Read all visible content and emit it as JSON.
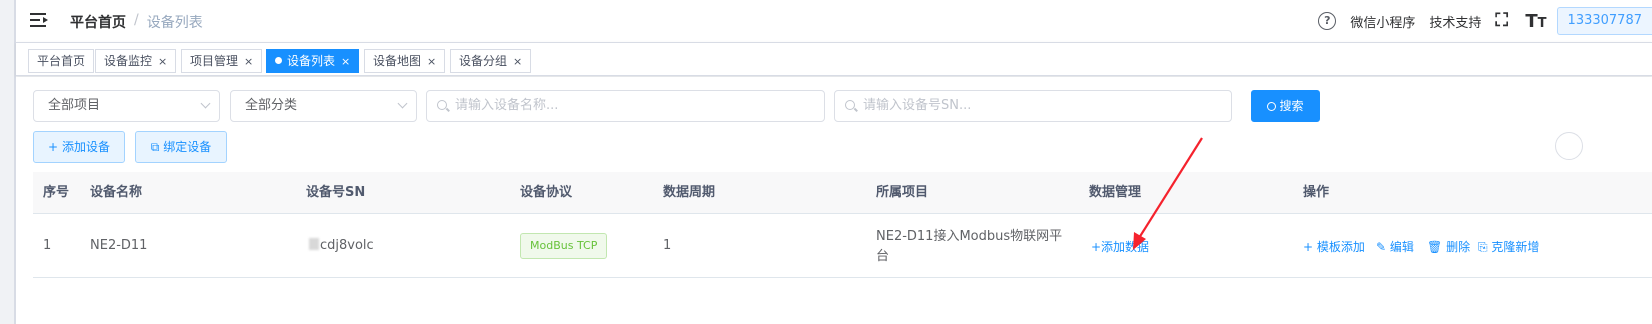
{
  "navbar": {
    "breadcrumb": {
      "home": "平台首页",
      "separator": "/",
      "current": "设备列表"
    },
    "right": {
      "mini_program": "微信小程序",
      "tech_support": "技术支持",
      "user": "133307787"
    }
  },
  "tags": [
    {
      "label": "平台首页",
      "closable": false
    },
    {
      "label": "设备监控",
      "closable": true
    },
    {
      "label": "项目管理",
      "closable": true
    },
    {
      "label": "设备列表",
      "closable": true,
      "active": true
    },
    {
      "label": "设备地图",
      "closable": true
    },
    {
      "label": "设备分组",
      "closable": true
    }
  ],
  "tag_close": "×",
  "filters": {
    "project_select": "全部项目",
    "category_select": "全部分类",
    "name_placeholder": "请输入设备名称...",
    "sn_placeholder": "请输入设备号SN...",
    "search_label": "搜索"
  },
  "actions": {
    "add_device": "添加设备",
    "bind_device": "绑定设备"
  },
  "table": {
    "headers": [
      "序号",
      "设备名称",
      "设备号SN",
      "设备协议",
      "数据周期",
      "所属项目",
      "数据管理",
      "操作"
    ],
    "rows": [
      {
        "index": "1",
        "name": "NE2-D11",
        "sn": "cdj8volc",
        "protocol": "ModBus TCP",
        "period": "1",
        "project_line1": "NE2-D11接入Modbus物联网平",
        "project_line2": "台",
        "data_mgmt": "+添加数据",
        "ops": {
          "template_add": "模板添加",
          "edit": "编辑",
          "delete": "删除",
          "clone": "克隆新增"
        }
      }
    ]
  },
  "colors": {
    "primary": "#1890ff",
    "success": "#67c23a",
    "annotation_arrow": "#f5222d"
  },
  "icons": [
    "hamburger-icon",
    "help-icon",
    "fullscreen-icon",
    "text-size-icon",
    "search-icon",
    "plus-icon",
    "link-icon",
    "edit-icon",
    "delete-icon",
    "copy-icon"
  ]
}
